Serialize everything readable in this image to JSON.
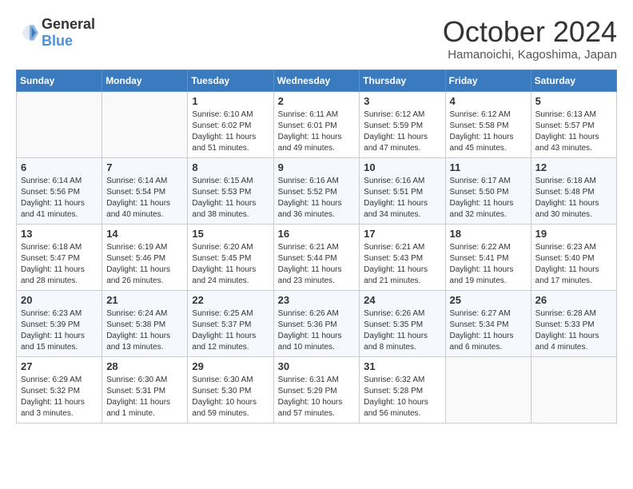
{
  "header": {
    "logo_general": "General",
    "logo_blue": "Blue",
    "month_title": "October 2024",
    "location": "Hamanoichi, Kagoshima, Japan"
  },
  "weekdays": [
    "Sunday",
    "Monday",
    "Tuesday",
    "Wednesday",
    "Thursday",
    "Friday",
    "Saturday"
  ],
  "weeks": [
    [
      {
        "day": "",
        "empty": true
      },
      {
        "day": "",
        "empty": true
      },
      {
        "day": "1",
        "sunrise": "6:10 AM",
        "sunset": "6:02 PM",
        "daylight": "11 hours and 51 minutes."
      },
      {
        "day": "2",
        "sunrise": "6:11 AM",
        "sunset": "6:01 PM",
        "daylight": "11 hours and 49 minutes."
      },
      {
        "day": "3",
        "sunrise": "6:12 AM",
        "sunset": "5:59 PM",
        "daylight": "11 hours and 47 minutes."
      },
      {
        "day": "4",
        "sunrise": "6:12 AM",
        "sunset": "5:58 PM",
        "daylight": "11 hours and 45 minutes."
      },
      {
        "day": "5",
        "sunrise": "6:13 AM",
        "sunset": "5:57 PM",
        "daylight": "11 hours and 43 minutes."
      }
    ],
    [
      {
        "day": "6",
        "sunrise": "6:14 AM",
        "sunset": "5:56 PM",
        "daylight": "11 hours and 41 minutes."
      },
      {
        "day": "7",
        "sunrise": "6:14 AM",
        "sunset": "5:54 PM",
        "daylight": "11 hours and 40 minutes."
      },
      {
        "day": "8",
        "sunrise": "6:15 AM",
        "sunset": "5:53 PM",
        "daylight": "11 hours and 38 minutes."
      },
      {
        "day": "9",
        "sunrise": "6:16 AM",
        "sunset": "5:52 PM",
        "daylight": "11 hours and 36 minutes."
      },
      {
        "day": "10",
        "sunrise": "6:16 AM",
        "sunset": "5:51 PM",
        "daylight": "11 hours and 34 minutes."
      },
      {
        "day": "11",
        "sunrise": "6:17 AM",
        "sunset": "5:50 PM",
        "daylight": "11 hours and 32 minutes."
      },
      {
        "day": "12",
        "sunrise": "6:18 AM",
        "sunset": "5:48 PM",
        "daylight": "11 hours and 30 minutes."
      }
    ],
    [
      {
        "day": "13",
        "sunrise": "6:18 AM",
        "sunset": "5:47 PM",
        "daylight": "11 hours and 28 minutes."
      },
      {
        "day": "14",
        "sunrise": "6:19 AM",
        "sunset": "5:46 PM",
        "daylight": "11 hours and 26 minutes."
      },
      {
        "day": "15",
        "sunrise": "6:20 AM",
        "sunset": "5:45 PM",
        "daylight": "11 hours and 24 minutes."
      },
      {
        "day": "16",
        "sunrise": "6:21 AM",
        "sunset": "5:44 PM",
        "daylight": "11 hours and 23 minutes."
      },
      {
        "day": "17",
        "sunrise": "6:21 AM",
        "sunset": "5:43 PM",
        "daylight": "11 hours and 21 minutes."
      },
      {
        "day": "18",
        "sunrise": "6:22 AM",
        "sunset": "5:41 PM",
        "daylight": "11 hours and 19 minutes."
      },
      {
        "day": "19",
        "sunrise": "6:23 AM",
        "sunset": "5:40 PM",
        "daylight": "11 hours and 17 minutes."
      }
    ],
    [
      {
        "day": "20",
        "sunrise": "6:23 AM",
        "sunset": "5:39 PM",
        "daylight": "11 hours and 15 minutes."
      },
      {
        "day": "21",
        "sunrise": "6:24 AM",
        "sunset": "5:38 PM",
        "daylight": "11 hours and 13 minutes."
      },
      {
        "day": "22",
        "sunrise": "6:25 AM",
        "sunset": "5:37 PM",
        "daylight": "11 hours and 12 minutes."
      },
      {
        "day": "23",
        "sunrise": "6:26 AM",
        "sunset": "5:36 PM",
        "daylight": "11 hours and 10 minutes."
      },
      {
        "day": "24",
        "sunrise": "6:26 AM",
        "sunset": "5:35 PM",
        "daylight": "11 hours and 8 minutes."
      },
      {
        "day": "25",
        "sunrise": "6:27 AM",
        "sunset": "5:34 PM",
        "daylight": "11 hours and 6 minutes."
      },
      {
        "day": "26",
        "sunrise": "6:28 AM",
        "sunset": "5:33 PM",
        "daylight": "11 hours and 4 minutes."
      }
    ],
    [
      {
        "day": "27",
        "sunrise": "6:29 AM",
        "sunset": "5:32 PM",
        "daylight": "11 hours and 3 minutes."
      },
      {
        "day": "28",
        "sunrise": "6:30 AM",
        "sunset": "5:31 PM",
        "daylight": "11 hours and 1 minute."
      },
      {
        "day": "29",
        "sunrise": "6:30 AM",
        "sunset": "5:30 PM",
        "daylight": "10 hours and 59 minutes."
      },
      {
        "day": "30",
        "sunrise": "6:31 AM",
        "sunset": "5:29 PM",
        "daylight": "10 hours and 57 minutes."
      },
      {
        "day": "31",
        "sunrise": "6:32 AM",
        "sunset": "5:28 PM",
        "daylight": "10 hours and 56 minutes."
      },
      {
        "day": "",
        "empty": true
      },
      {
        "day": "",
        "empty": true
      }
    ]
  ],
  "labels": {
    "sunrise": "Sunrise:",
    "sunset": "Sunset:",
    "daylight": "Daylight:"
  }
}
